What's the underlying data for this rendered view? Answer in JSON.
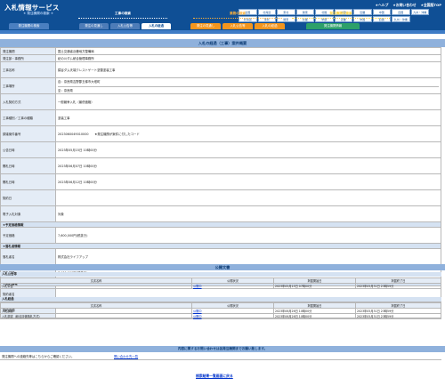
{
  "site": {
    "title": "入札情報サービス",
    "utils": [
      "★ヘルプ",
      "★お問い合わせ",
      "★全国版TOP"
    ]
  },
  "prefectures": [
    "全国",
    "北海道",
    "東北",
    "関東",
    "北陸",
    "中部",
    "近畿",
    "中国",
    "四国",
    "九州・沖縄",
    "北海道",
    "東北",
    "関東",
    "北陸",
    "中部",
    "近畿",
    "中国",
    "四国",
    "九州・沖縄"
  ],
  "categories": {
    "a": "★ 発注機関の検索 ★",
    "b": "工事の検索",
    "c": "業務の検索",
    "d": "発注機関の検索"
  },
  "tabs": {
    "a": "発注機関の検索",
    "b1": "発注の見通し",
    "b2": "入札公告等",
    "b3": "入札の経過",
    "c1": "発注の見通し",
    "c2": "入札公告等",
    "c3": "入札の経過",
    "d1": "発注機関情報"
  },
  "panel_title": "入札の経過（工事）案件概要",
  "info": [
    {
      "label": "発注機関",
      "value": "国土交通省近畿地方整備局"
    },
    {
      "label": "発注部・事務所",
      "value": "紀の川ダム統合管理事務所"
    },
    {
      "label": "工事名称",
      "value": "猿谷ダム天端クレストゲート塗替塗装工事"
    },
    {
      "label": "工事場所",
      "value": "自：奈良県吉野郡五條市大塔町",
      "value2": "至：奈良県"
    },
    {
      "label": "入札契約方式",
      "value": "一般競争入札（最低価格）"
    },
    {
      "label": "工事種別／工事の種類",
      "value": "塗装工事"
    },
    {
      "label": "調達案件番号",
      "value": "2023060049010000　　★発注機関が案件に付したコード"
    },
    {
      "label": "公告日時",
      "value": "2023年05月15日 10時00分"
    },
    {
      "label": "開札日時",
      "value": "2023年06月07日 10時00分"
    },
    {
      "label": "開札日時",
      "value": "2023年06月12日 10時00分"
    },
    {
      "label": "契約日",
      "value": ""
    },
    {
      "label": "電子入札対象",
      "value": "対象"
    }
  ],
  "yotei": {
    "section": "★予定価格情報",
    "label": "予定価格",
    "value": "7,600,000円(税抜き)"
  },
  "rakusatsu": {
    "section": "★落札者情報",
    "l1": "落札者名",
    "v1": "株式会社ライフアップ",
    "l2": "落札価格",
    "v2": "7,130,000円(税抜き)"
  },
  "keiyaku": {
    "section": "★契約情報",
    "l1": "契約者名",
    "l2": "契約金額",
    "v1": "",
    "v2": ""
  },
  "kohyo": {
    "title": "公開文書",
    "sec1": "入札公告等",
    "cols": [
      "文書名称",
      "公開状況",
      "掲載開始日",
      "掲載終了日"
    ],
    "rows1": [
      {
        "name": "入札公告",
        "status": "公開中",
        "start": "2023年05月15日 07時00分",
        "end": "2023年05月31日 23時59分"
      }
    ],
    "sec2": "入札経過",
    "rows2": [
      {
        "name": "入札調書",
        "status": "公開中",
        "start": "2023年06月26日 10時00分",
        "end": "2023年05月31日 23時59分"
      },
      {
        "name": "入札調書（総合評価落札方式）",
        "status": "公開中",
        "start": "2023年06月26日 10時00分",
        "end": "2023年05月31日 23時59分"
      }
    ]
  },
  "notice": {
    "title": "内容に関するお問い合わせは各発注機関までお願い致します。",
    "label": "発注機関への連絡先等はこちらからご確認ください。",
    "link": "問い合わせ先一覧"
  },
  "back_link": "検索結果一覧画面に戻る"
}
